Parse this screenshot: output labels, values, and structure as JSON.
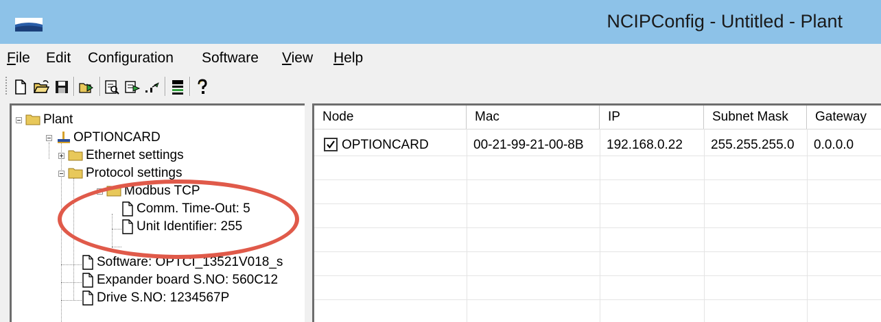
{
  "window": {
    "title": "NCIPConfig - Untitled - Plant",
    "titlebar_color": "#8dc2e8"
  },
  "menu": {
    "file": {
      "accel": "F",
      "rest": "ile"
    },
    "edit": {
      "label": "Edit"
    },
    "configuration": {
      "label": "Configuration"
    },
    "software": {
      "label": "Software"
    },
    "view": {
      "accel": "V",
      "rest": "iew"
    },
    "help": {
      "accel": "H",
      "rest": "elp"
    }
  },
  "toolbar": {
    "buttons": [
      "new-icon",
      "open-icon",
      "save-icon",
      "discover-icon",
      "find-icon",
      "send-icon",
      "ping-icon",
      "download-icon",
      "help-icon"
    ]
  },
  "tree": {
    "root": "Plant",
    "card": "OPTIONCARD",
    "ethernet": "Ethernet settings",
    "protocol": "Protocol settings",
    "modbus": "Modbus TCP",
    "timeout": "Comm. Time-Out: 5",
    "unit_id": "Unit Identifier: 255",
    "software": "Software: OPTCI_13521V018_s",
    "expander": "Expander board S.NO: 560C12",
    "drive": "Drive S.NO: 1234567P"
  },
  "annotation": {
    "color": "#e05a4a"
  },
  "list": {
    "columns": [
      "Node",
      "Mac",
      "IP",
      "Subnet Mask",
      "Gateway"
    ],
    "rows": [
      {
        "checked": true,
        "node": "OPTIONCARD",
        "mac": "00-21-99-21-00-8B",
        "ip": "192.168.0.22",
        "subnet": "255.255.255.0",
        "gateway": "0.0.0.0"
      }
    ]
  }
}
